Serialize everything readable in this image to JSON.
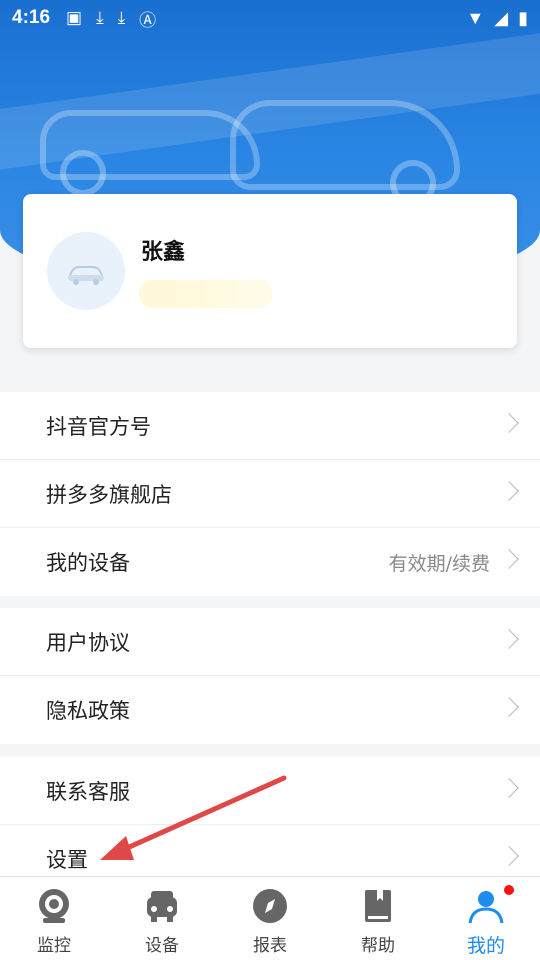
{
  "status_bar": {
    "time": "4:16"
  },
  "profile": {
    "name": "张鑫"
  },
  "menu": {
    "group1": [
      {
        "label": "抖音官方号",
        "sub": ""
      },
      {
        "label": "拼多多旗舰店",
        "sub": ""
      },
      {
        "label": "我的设备",
        "sub": "有效期/续费"
      }
    ],
    "group2": [
      {
        "label": "用户协议",
        "sub": ""
      },
      {
        "label": "隐私政策",
        "sub": ""
      }
    ],
    "group3": [
      {
        "label": "联系客服",
        "sub": ""
      },
      {
        "label": "设置",
        "sub": ""
      }
    ]
  },
  "tabs": [
    {
      "label": "监控",
      "icon": "camera-icon"
    },
    {
      "label": "设备",
      "icon": "car-front-icon"
    },
    {
      "label": "报表",
      "icon": "compass-icon"
    },
    {
      "label": "帮助",
      "icon": "book-icon"
    },
    {
      "label": "我的",
      "icon": "person-icon",
      "active": true
    }
  ],
  "colors": {
    "primary": "#1f8cf0",
    "annotation_arrow": "#e04848"
  }
}
